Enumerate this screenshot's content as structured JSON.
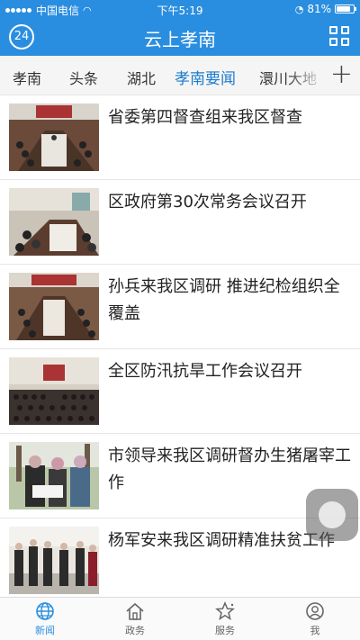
{
  "status_bar": {
    "carrier": "中国电信",
    "time": "下午5:19",
    "battery": "81%",
    "battery_level": 0.81
  },
  "header": {
    "logo_text": "24",
    "title": "云上孝南"
  },
  "tabs": [
    {
      "label": "孝南",
      "active": false
    },
    {
      "label": "头条",
      "active": false
    },
    {
      "label": "湖北",
      "active": false
    },
    {
      "label": "孝南要闻",
      "active": true
    },
    {
      "label": "澴川大地",
      "active": false
    }
  ],
  "tab_add_label": "+",
  "news": [
    {
      "title": "省委第四督查组来我区督查"
    },
    {
      "title": "区政府第30次常务会议召开"
    },
    {
      "title": "孙兵来我区调研 推进纪检组织全覆盖"
    },
    {
      "title": "全区防汛抗旱工作会议召开"
    },
    {
      "title": "市领导来我区调研督办生猪屠宰工作"
    },
    {
      "title": "杨军安来我区调研精准扶贫工作"
    }
  ],
  "bottom_nav": [
    {
      "label": "新闻",
      "icon": "globe-icon",
      "active": true
    },
    {
      "label": "政务",
      "icon": "home-icon",
      "active": false
    },
    {
      "label": "服务",
      "icon": "star-icon",
      "active": false
    },
    {
      "label": "我",
      "icon": "user-icon",
      "active": false
    }
  ],
  "colors": {
    "brand_blue": "#2a8ee0",
    "active_tab": "#1b7ccd"
  }
}
